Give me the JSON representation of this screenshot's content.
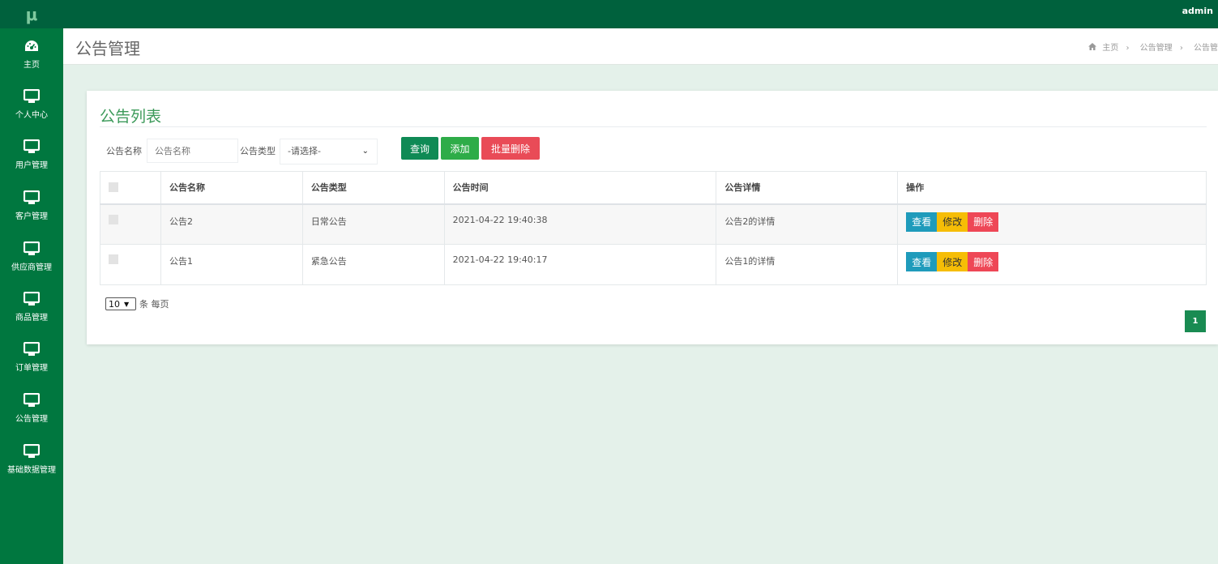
{
  "app": {
    "logo": "μ",
    "user": "admin"
  },
  "sidebar": {
    "items": [
      {
        "label": "主页",
        "icon": "dashboard-icon"
      },
      {
        "label": "个人中心",
        "icon": "monitor-icon"
      },
      {
        "label": "用户管理",
        "icon": "monitor-icon"
      },
      {
        "label": "客户管理",
        "icon": "monitor-icon"
      },
      {
        "label": "供应商管理",
        "icon": "monitor-icon"
      },
      {
        "label": "商品管理",
        "icon": "monitor-icon"
      },
      {
        "label": "订单管理",
        "icon": "monitor-icon"
      },
      {
        "label": "公告管理",
        "icon": "monitor-icon"
      },
      {
        "label": "基础数据管理",
        "icon": "monitor-icon"
      }
    ]
  },
  "header": {
    "title": "公告管理",
    "breadcrumb": [
      "主页",
      "公告管理",
      "公告管"
    ]
  },
  "card": {
    "title": "公告列表"
  },
  "filter": {
    "name_label": "公告名称",
    "name_placeholder": "公告名称",
    "type_label": "公告类型",
    "type_value": "-请选择-",
    "search_button": "查询",
    "add_button": "添加",
    "batch_delete_button": "批量删除"
  },
  "table": {
    "headers": [
      "公告名称",
      "公告类型",
      "公告时间",
      "公告详情",
      "操作"
    ],
    "rows": [
      {
        "name": "公告2",
        "type": "日常公告",
        "time": "2021-04-22 19:40:38",
        "detail": "公告2的详情"
      },
      {
        "name": "公告1",
        "type": "紧急公告",
        "time": "2021-04-22 19:40:17",
        "detail": "公告1的详情"
      }
    ],
    "actions": {
      "view": "查看",
      "edit": "修改",
      "delete": "删除"
    }
  },
  "pagination": {
    "page_size": "10",
    "per_page_label": "条 每页",
    "current_page": "1"
  },
  "colors": {
    "topbar": "#00613d",
    "sidebar": "#00773f",
    "accent_green": "#3c9a5a",
    "btn_search": "#0f8a55",
    "btn_add": "#2eac48",
    "btn_delete": "#e94b57",
    "act_view": "#1f9bbb",
    "act_edit": "#f6bd06",
    "act_delete": "#ee4756"
  }
}
